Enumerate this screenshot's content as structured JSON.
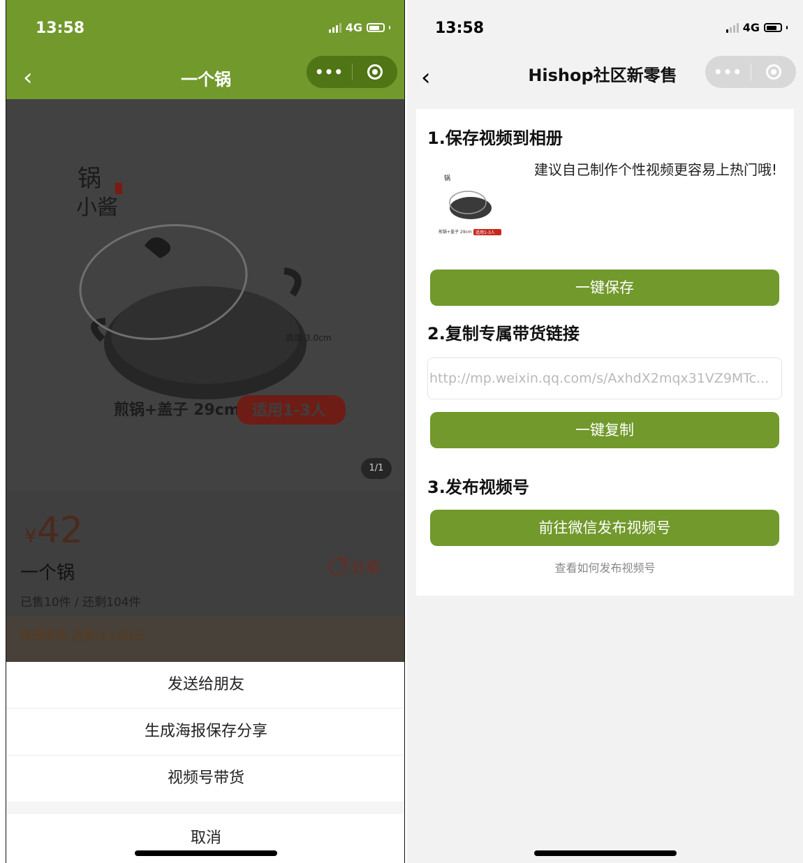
{
  "left": {
    "status": {
      "time": "13:58",
      "network": "4G"
    },
    "nav": {
      "title": "一个锅",
      "more_icon": "ellipsis-icon",
      "close_icon": "target-icon"
    },
    "product_image": {
      "brand_lines": [
        "锅",
        "小酱"
      ],
      "caption": "煎锅+盖子 29cm",
      "badge": "适用1-3人",
      "height_note": "高度:3.0cm"
    },
    "pager": "1/1",
    "price": {
      "currency": "¥",
      "value": "42"
    },
    "product_name": "一个锅",
    "share_label": "分享",
    "sold_text": "已售10件 / 还剩104件",
    "shipping_text": "快递到家 运费:13.00元",
    "sheet": {
      "items": [
        "发送给朋友",
        "生成海报保存分享",
        "视频号带货"
      ],
      "cancel": "取消"
    }
  },
  "right": {
    "status": {
      "time": "13:58",
      "network": "4G"
    },
    "nav": {
      "title": "Hishop社区新零售"
    },
    "step1": {
      "title": "1.保存视频到相册",
      "tip": "建议自己制作个性视频更容易上热门哦!",
      "thumb_caption": "煎锅+盖子 29cm",
      "thumb_badge": "适用1-3人",
      "button": "一键保存"
    },
    "step2": {
      "title": "2.复制专属带货链接",
      "link": "http://mp.weixin.qq.com/s/AxhdX2mqx31VZ9MTc...",
      "button": "一键复制"
    },
    "step3": {
      "title": "3.发布视频号",
      "button": "前往微信发布视频号",
      "howto": "查看如何发布视频号"
    }
  },
  "colors": {
    "accent": "#71992c",
    "capsule_dark": "#4f7514",
    "badge_red": "#c8281e"
  }
}
